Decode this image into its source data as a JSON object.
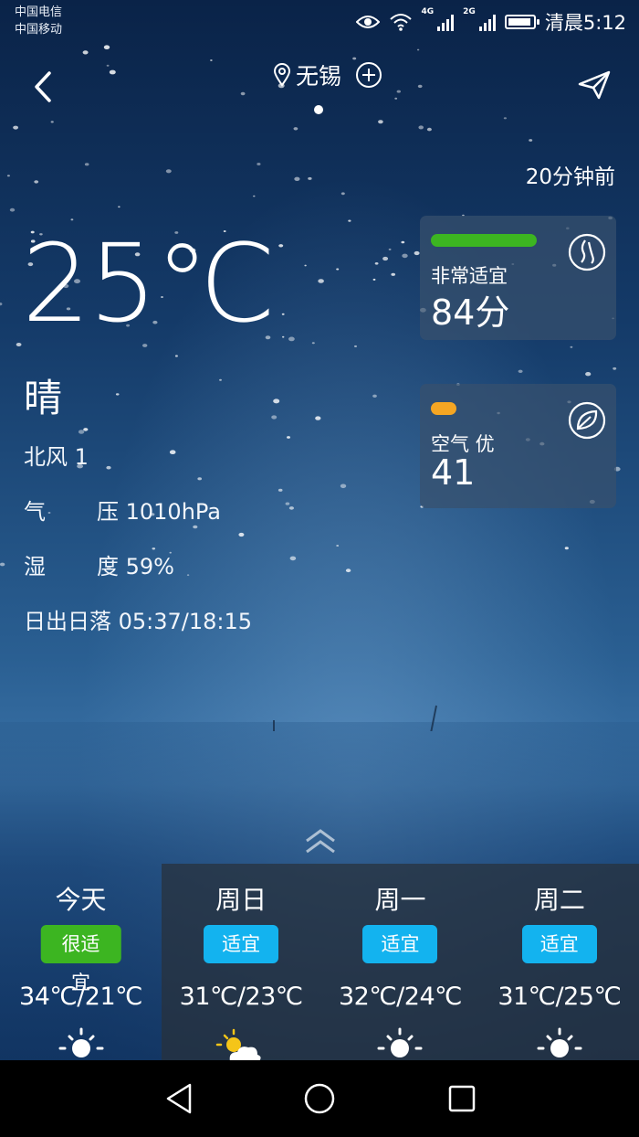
{
  "status_bar": {
    "carrier_1": "中国电信",
    "carrier_2": "中国移动",
    "network_1": "4G",
    "network_2": "2G",
    "time": "清晨5:12",
    "icons": [
      "eye-icon",
      "wifi-icon",
      "signal-icon",
      "signal-icon",
      "battery-icon"
    ]
  },
  "header": {
    "city": "无锡",
    "page_dots": 1,
    "updated": "20分钟前"
  },
  "current": {
    "temperature": "25℃",
    "condition": "晴",
    "wind": "北风 1",
    "pressure_key": "气",
    "pressure_val": "压 1010hPa",
    "humidity_key": "湿",
    "humidity_val": "度 59%",
    "sun": "日出日落 05:37/18:15"
  },
  "comfort_card": {
    "label": "非常适宜",
    "value": "84分",
    "bar_color": "#3cb521",
    "icon": "comfort-icon"
  },
  "air_card": {
    "label": "空气 优",
    "value": "41",
    "bar_color": "#f5a623",
    "icon": "leaf-icon"
  },
  "forecast": [
    {
      "day": "今天",
      "badge": "很适宜",
      "badge_color": "#3cb521",
      "range": "34℃/21℃",
      "icon": "sun-icon"
    },
    {
      "day": "周日",
      "badge": "适宜",
      "badge_color": "#13b3ef",
      "range": "31℃/23℃",
      "icon": "partly-cloudy-icon"
    },
    {
      "day": "周一",
      "badge": "适宜",
      "badge_color": "#13b3ef",
      "range": "32℃/24℃",
      "icon": "sun-icon"
    },
    {
      "day": "周二",
      "badge": "适宜",
      "badge_color": "#13b3ef",
      "range": "31℃/25℃",
      "icon": "sun-icon"
    }
  ]
}
